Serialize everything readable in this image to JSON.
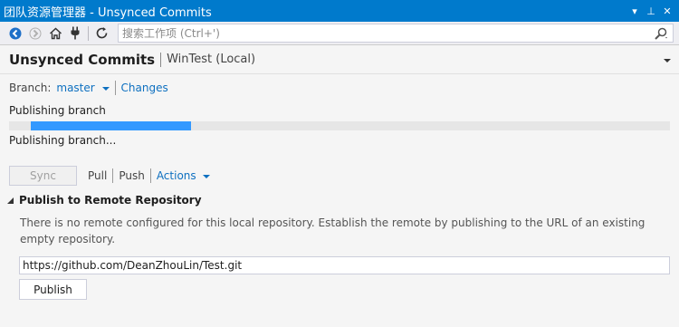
{
  "window": {
    "title": "团队资源管理器 - Unsynced Commits",
    "controls": {
      "dropdown": "▾",
      "pin": "⊥",
      "close": "✕"
    }
  },
  "toolbar": {
    "search_placeholder": "搜索工作项 (Ctrl+')",
    "icons": [
      "back-icon",
      "forward-icon",
      "home-icon",
      "connect-icon",
      "refresh-icon",
      "search-icon"
    ],
    "accent": "#1e6fc8"
  },
  "header": {
    "title": "Unsynced Commits",
    "repo": "WinTest (Local)"
  },
  "branch": {
    "label": "Branch:",
    "name": "master",
    "changes_link": "Changes"
  },
  "progress": {
    "label": "Publishing branch",
    "fraction": 0.25,
    "status": "Publishing branch..."
  },
  "actions": {
    "sync_label": "Sync",
    "pull_label": "Pull",
    "push_label": "Push",
    "actions_label": "Actions"
  },
  "publish": {
    "section_title": "Publish to Remote Repository",
    "description": "There is no remote configured for this local repository. Establish the remote by publishing to the URL of an existing empty repository.",
    "url_value": "https://github.com/DeanZhouLin/Test.git",
    "button_label": "Publish"
  },
  "colors": {
    "titlebar": "#007acc",
    "link": "#0e70c0",
    "progress_fill": "#3399ff"
  }
}
